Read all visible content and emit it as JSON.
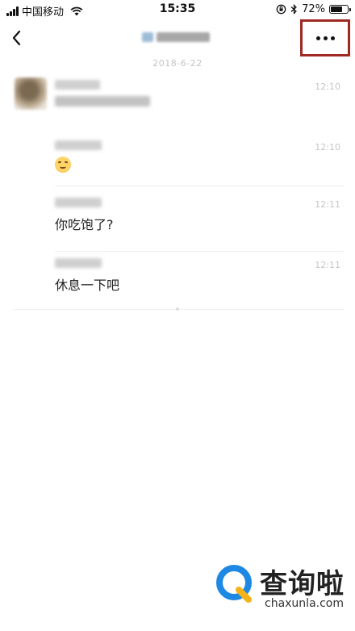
{
  "status_bar": {
    "carrier": "中国移动",
    "time": "15:35",
    "battery_text": "72%",
    "battery_level": 0.72,
    "icons": [
      "signal-icon",
      "wifi-icon",
      "rotation-lock-icon",
      "bluetooth-icon",
      "battery-icon"
    ]
  },
  "nav": {
    "back_icon": "chevron-left-icon",
    "more_icon": "more-dots-icon",
    "highlight_color": "#9e2a22"
  },
  "chat": {
    "date": "2018-6-22",
    "messages": [
      {
        "time": "12:10",
        "text": ""
      },
      {
        "time": "12:10",
        "text": "",
        "emoji": "smiling-face-emoji"
      },
      {
        "time": "12:11",
        "text": "你吃饱了?"
      },
      {
        "time": "12:11",
        "text": "休息一下吧"
      }
    ]
  },
  "watermark": {
    "brand": "查询啦",
    "url": "chaxunla.com",
    "logo_color": "#1e88e5",
    "logo_accent": "#f6b21a"
  }
}
